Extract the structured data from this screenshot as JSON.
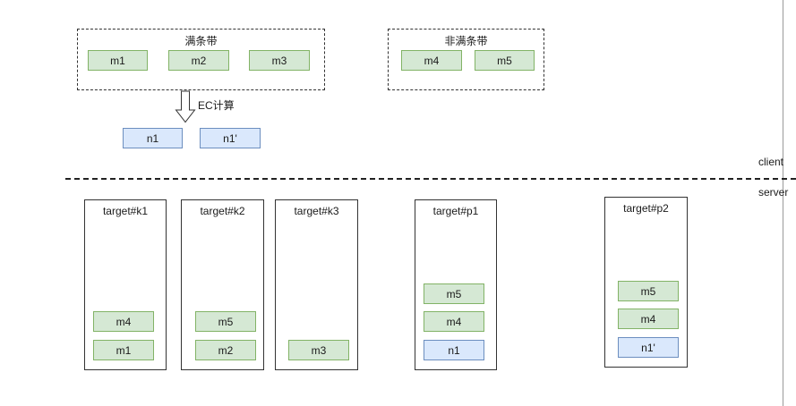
{
  "groups": {
    "full": {
      "title": "满条带",
      "blocks": [
        "m1",
        "m2",
        "m3"
      ]
    },
    "partial": {
      "title": "非满条带",
      "blocks": [
        "m4",
        "m5"
      ]
    }
  },
  "ec": {
    "label": "EC计算",
    "outputs": [
      "n1",
      "n1'"
    ]
  },
  "zones": {
    "client": "client",
    "server": "server"
  },
  "targets": [
    {
      "title": "target#k1",
      "blocks": [
        {
          "label": "m4",
          "color": "green"
        },
        {
          "label": "m1",
          "color": "green"
        }
      ]
    },
    {
      "title": "target#k2",
      "blocks": [
        {
          "label": "m5",
          "color": "green"
        },
        {
          "label": "m2",
          "color": "green"
        }
      ]
    },
    {
      "title": "target#k3",
      "blocks": [
        {
          "label": "m3",
          "color": "green"
        }
      ]
    },
    {
      "title": "target#p1",
      "blocks": [
        {
          "label": "m5",
          "color": "green"
        },
        {
          "label": "m4",
          "color": "green"
        },
        {
          "label": "n1",
          "color": "blue"
        }
      ]
    },
    {
      "title": "target#p2",
      "blocks": [
        {
          "label": "m5",
          "color": "green"
        },
        {
          "label": "m4",
          "color": "green"
        },
        {
          "label": "n1'",
          "color": "blue"
        }
      ]
    }
  ],
  "colors": {
    "green_fill": "#d5e8d4",
    "green_stroke": "#82b366",
    "blue_fill": "#dae8fc",
    "blue_stroke": "#6c8ebf"
  }
}
